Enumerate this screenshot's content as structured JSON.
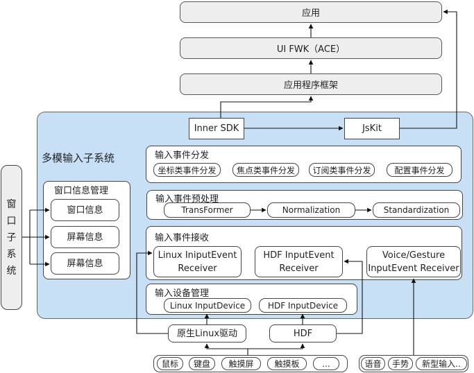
{
  "top_layers": {
    "app": "应用",
    "ui_fwk": "UI FWK（ACE）",
    "app_framework": "应用程序框架"
  },
  "subsystem": {
    "title": "多模输入子系统",
    "inner_sdk": "Inner SDK",
    "jskit": "JsKit",
    "dispatch": {
      "title": "输入事件分发",
      "items": [
        "坐标类事件分发",
        "焦点类事件分发",
        "订阅类事件分发",
        "配置事件分发"
      ]
    },
    "preprocess": {
      "title": "输入事件预处理",
      "items": [
        "TransFormer",
        "Normalization",
        "Standardization"
      ]
    },
    "receive": {
      "title": "输入事件接收",
      "items": [
        {
          "line1": "Linux IniputEvent",
          "line2": "Receiver"
        },
        {
          "line1": "HDF InputEvent",
          "line2": "Receiver"
        },
        {
          "line1": "Voice/Gesture",
          "line2": "InputEvent Receiver"
        }
      ]
    },
    "device_mgmt": {
      "title": "输入设备管理",
      "items": [
        "Linux InputDevice",
        "HDF InputDevice"
      ]
    },
    "window_info_mgmt": {
      "title": "窗口信息管理",
      "items": [
        "窗口信息",
        "屏幕信息",
        "屏幕信息"
      ]
    }
  },
  "window_subsystem": {
    "chars": [
      "窗",
      "口",
      "子",
      "系",
      "统"
    ]
  },
  "drivers": {
    "native_linux": "原生Linux驱动",
    "hdf": "HDF"
  },
  "devices": {
    "items": [
      "鼠标",
      "键盘",
      "触摸屏",
      "触摸板",
      "..."
    ]
  },
  "new_inputs": {
    "items": [
      "语音",
      "手势",
      "新型输入.."
    ]
  }
}
